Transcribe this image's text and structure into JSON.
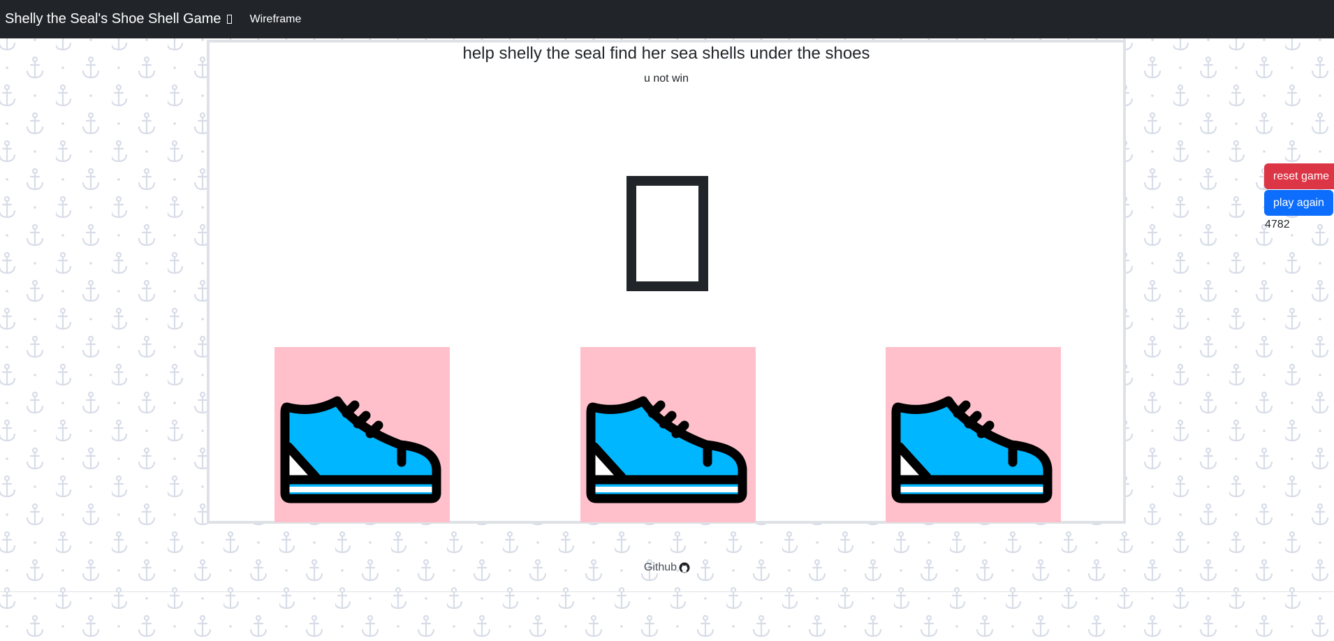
{
  "navbar": {
    "brand": "Shelly the Seal's Shoe Shell Game",
    "links": [
      "Wireframe"
    ]
  },
  "game": {
    "title": "help shelly the seal find her sea shells under the shoes",
    "result": "u not win",
    "shoes": [
      {
        "icon": "sneaker-icon"
      },
      {
        "icon": "sneaker-icon"
      },
      {
        "icon": "sneaker-icon"
      }
    ]
  },
  "controls": {
    "reset_label": "reset game",
    "play_again_label": "play again",
    "counter": "4782"
  },
  "footer": {
    "github_label": "Github",
    "github_icon": "github-icon"
  },
  "colors": {
    "navbar": "#212529",
    "reset": "#dc3545",
    "play_again": "#0d6efd",
    "shoe_card": "#ffc0cb",
    "shoe_fill": "#00b7ff",
    "anchor_pattern": "#d7dce7"
  }
}
